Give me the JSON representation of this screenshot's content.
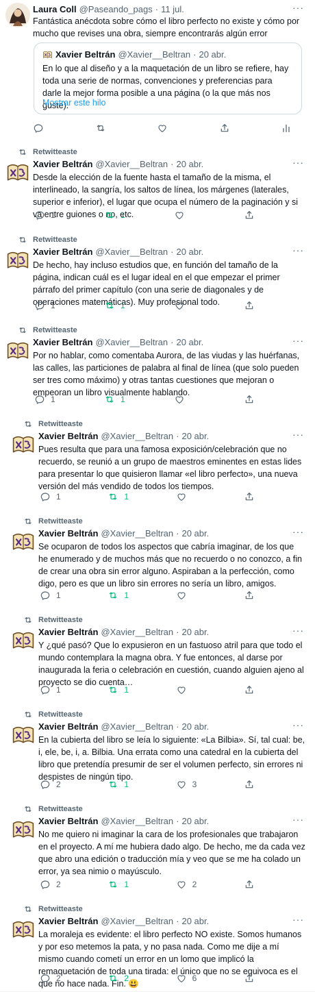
{
  "first_tweet": {
    "name": "Laura Coll",
    "handle": "@Paseando_pags",
    "sep": "·",
    "date": "11 jul.",
    "text": "Fantástica anécdota sobre cómo el libro perfecto no existe y cómo por mucho que revises una obra, siempre encontrarás algún error",
    "quote": {
      "name": "Xavier Beltrán",
      "handle": "@Xavier__Beltran",
      "sep": "·",
      "date": "20 abr.",
      "text": "En lo que al diseño y a la maquetación de un libro se refiere, hay toda una serie de normas, convenciones y preferencias para darle la mejor forma posible a una página (o la que más nos guste).",
      "link": "Mostrar este hilo"
    }
  },
  "retweet_label": "Retwitteaste",
  "author": {
    "name": "Xavier Beltrán",
    "handle": "@Xavier__Beltran",
    "sep": "·",
    "date": "20 abr.",
    "avatar_text": "XB"
  },
  "tweets": [
    {
      "text": "Desde la elección de la fuente hasta el tamaño de la misma, el interlineado, la sangría, los saltos de línea, los márgenes (laterales, superior e inferior), el lugar que ocupa el número de la paginación y si va entre guiones o no, etc.",
      "replies": "1",
      "retweets": "1",
      "likes": ""
    },
    {
      "text": "De hecho, hay incluso estudios que, en función del tamaño de la página, indican cuál es el lugar ideal en el que empezar el primer párrafo del primer capítulo (con una serie de diagonales y de operaciones matemáticas). Muy profesional todo.",
      "replies": "1",
      "retweets": "1",
      "likes": ""
    },
    {
      "text": "Por no hablar, como comentaba Aurora, de las viudas y las huérfanas, las calles, las particiones de palabra al final de línea (que solo pueden ser tres como máximo) y otras tantas cuestiones que mejoran o empeoran un libro visualmente hablando.",
      "replies": "1",
      "retweets": "1",
      "likes": ""
    },
    {
      "text": "Pues resulta que para una famosa exposición/celebración que no recuerdo, se reunió a un grupo de maestros eminentes en estas lides para presentar lo que quisieron llamar «el libro perfecto», una nueva versión del más vendido de todos los tiempos.",
      "replies": "1",
      "retweets": "1",
      "likes": ""
    },
    {
      "text": "Se ocuparon de todos los aspectos que cabría imaginar, de los que he enumerado y de muchos más que no recuerdo o no conozco, a fin de crear una obra sin error alguno. Aspiraban a la perfección, como digo, pero es que un libro sin errores no sería un libro, amigos.",
      "replies": "1",
      "retweets": "1",
      "likes": ""
    },
    {
      "text": "Y ¿qué pasó? Que lo expusieron en un fastuoso atril para que todo el mundo contemplara la magna obra. Y fue entonces, al darse por inaugurada la feria o celebración en cuestión, cuando alguien ajeno al proyecto se dio cuenta…",
      "replies": "1",
      "retweets": "1",
      "likes": ""
    },
    {
      "text": "En la cubierta del libro se leía lo siguiente: «La Bilbia». Sí, tal cual: be, i, ele, be, i, a. Bilbia. Una errata como una catedral en la cubierta del libro que pretendía presumir de ser el volumen perfecto, sin errores ni despistes de ningún tipo.",
      "replies": "2",
      "retweets": "1",
      "likes": "3"
    },
    {
      "text": "No me quiero ni imaginar la cara de los profesionales que trabajaron en el proyecto. A mí me hubiera dado algo. De hecho, me da cada vez que abro una edición o traducción mía y veo que se me ha colado un error, ya sea nimio o mayúsculo.",
      "replies": "2",
      "retweets": "1",
      "likes": "2"
    },
    {
      "text": "La moraleja es evidente: el libro perfecto NO existe. Somos humanos y por eso metemos la pata, y no pasa nada. Como me dije a mí mismo cuando cometí un error en un lomo que implicó la remaquetación de toda una tirada: el único que no se equivoca es el que no hace nada. Fin. 😃",
      "replies": "2",
      "retweets": "2",
      "likes": "6"
    }
  ],
  "colors": {
    "retweet_green": "#00ba7c",
    "link_blue": "#1d9bf0",
    "muted": "#536471"
  }
}
